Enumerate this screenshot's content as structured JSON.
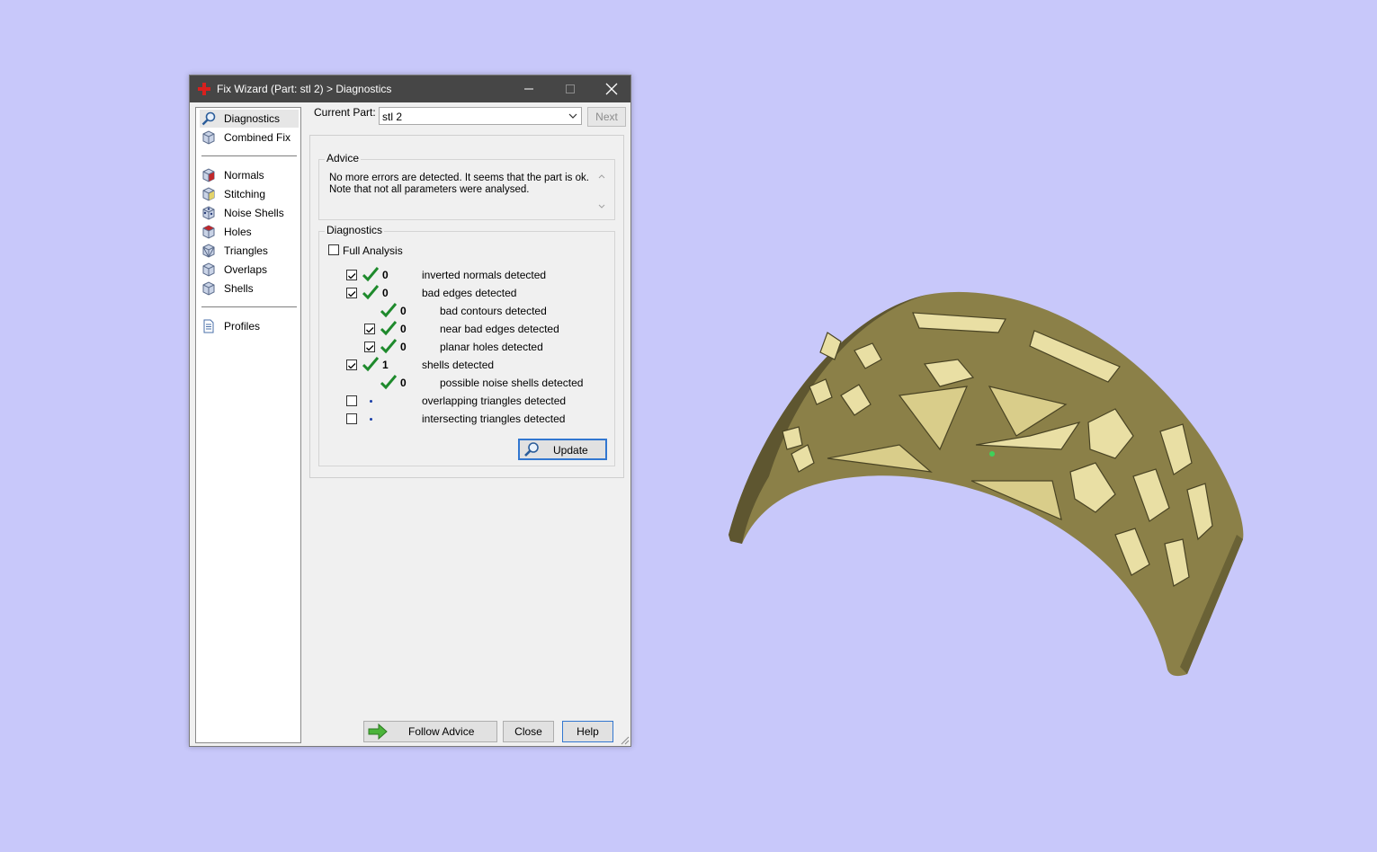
{
  "window": {
    "title": "Fix Wizard (Part: stl 2) > Diagnostics",
    "app_icon": "fix-wizard-icon",
    "controls": [
      "minimize-icon",
      "maximize-icon",
      "close-icon"
    ]
  },
  "nav": {
    "items": [
      {
        "label": "Diagnostics",
        "icon": "magnifier-icon",
        "selected": true
      },
      {
        "label": "Combined Fix",
        "icon": "cube-icon"
      },
      {
        "label": "Normals",
        "icon": "cube-red-icon"
      },
      {
        "label": "Stitching",
        "icon": "cube-yellow-icon"
      },
      {
        "label": "Noise Shells",
        "icon": "cube-dots-icon"
      },
      {
        "label": "Holes",
        "icon": "cube-red-top-icon"
      },
      {
        "label": "Triangles",
        "icon": "cube-triangles-icon"
      },
      {
        "label": "Overlaps",
        "icon": "cube-icon"
      },
      {
        "label": "Shells",
        "icon": "cube-icon"
      },
      {
        "label": "Profiles",
        "icon": "document-icon"
      }
    ]
  },
  "current_part": {
    "label": "Current Part:",
    "value": "stl 2",
    "next_label": "Next"
  },
  "advice": {
    "title": "Advice",
    "text": "No more errors are detected. It seems that the part is ok.\nNote that not all parameters were analysed."
  },
  "diagnostics": {
    "title": "Diagnostics",
    "full_analysis_label": "Full Analysis",
    "full_analysis_checked": false,
    "rows": [
      {
        "checked": true,
        "status": "ok",
        "count": "0",
        "label": "inverted normals detected",
        "indent": 0,
        "has_checkbox": true
      },
      {
        "checked": true,
        "status": "ok",
        "count": "0",
        "label": "bad edges detected",
        "indent": 0,
        "has_checkbox": true
      },
      {
        "checked": false,
        "status": "ok",
        "count": "0",
        "label": "bad contours detected",
        "indent": 1,
        "has_checkbox": false
      },
      {
        "checked": true,
        "status": "ok",
        "count": "0",
        "label": "near bad edges detected",
        "indent": 1,
        "has_checkbox": true
      },
      {
        "checked": true,
        "status": "ok",
        "count": "0",
        "label": "planar holes detected",
        "indent": 1,
        "has_checkbox": true
      },
      {
        "checked": true,
        "status": "ok",
        "count": "1",
        "label": "shells detected",
        "indent": 0,
        "has_checkbox": true
      },
      {
        "checked": false,
        "status": "ok",
        "count": "0",
        "label": "possible noise shells detected",
        "indent": 1,
        "has_checkbox": false
      },
      {
        "checked": false,
        "status": "not-analysed",
        "count": "",
        "label": "overlapping triangles detected",
        "indent": 0,
        "has_checkbox": true
      },
      {
        "checked": false,
        "status": "not-analysed",
        "count": "",
        "label": "intersecting triangles detected",
        "indent": 0,
        "has_checkbox": true
      }
    ],
    "update_label": "Update"
  },
  "footer": {
    "follow_advice": "Follow Advice",
    "close": "Close",
    "help": "Help"
  },
  "colors": {
    "background": "#c8c8fa",
    "titlebar": "#464646",
    "model": "#8b8048",
    "tick": "#1e8a2c",
    "accent": "#3277d0"
  }
}
